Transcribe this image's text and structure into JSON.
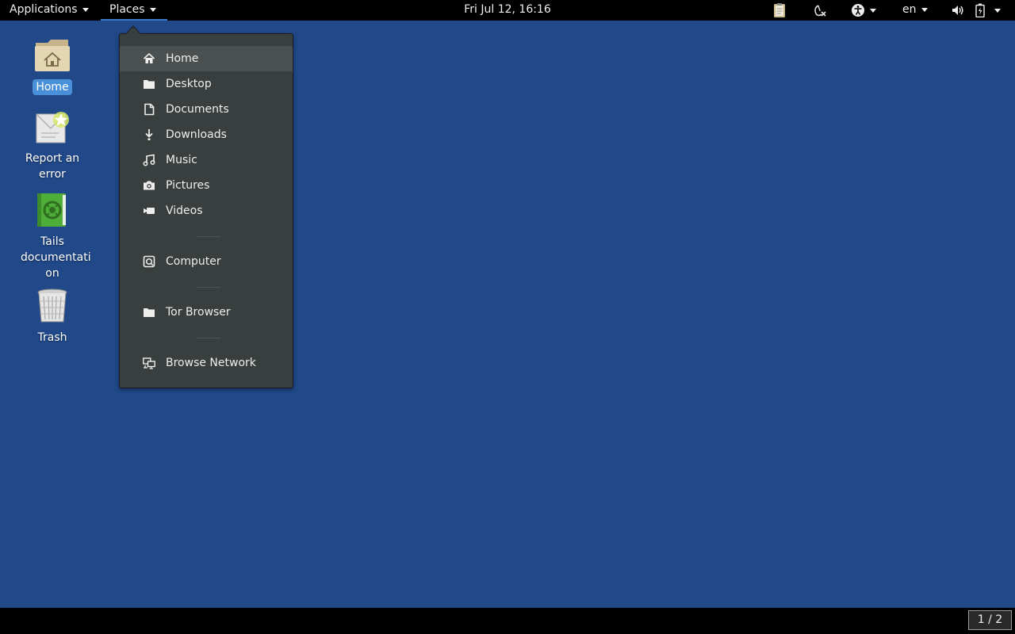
{
  "topbar": {
    "applications_label": "Applications",
    "places_label": "Places",
    "clock": "Fri Jul 12, 16:16",
    "language": "en",
    "icons": [
      "clipboard-icon",
      "tor-status-icon",
      "accessibility-icon",
      "volume-icon",
      "battery-icon"
    ]
  },
  "desktop": {
    "icons": [
      {
        "label": "Home",
        "icon": "home-folder-icon",
        "selected": true
      },
      {
        "label": "Report an error",
        "label_lines": [
          "Report an",
          "error"
        ],
        "icon": "report-error-icon"
      },
      {
        "label": "Tails documentation",
        "label_lines": [
          "Tails",
          "documentati",
          "on"
        ],
        "icon": "tails-documentation-icon"
      },
      {
        "label": "Trash",
        "icon": "trash-icon"
      }
    ]
  },
  "places_menu": {
    "items": [
      {
        "label": "Home",
        "icon": "home-icon"
      },
      {
        "label": "Desktop",
        "icon": "folder-icon"
      },
      {
        "label": "Documents",
        "icon": "document-icon"
      },
      {
        "label": "Downloads",
        "icon": "download-icon"
      },
      {
        "label": "Music",
        "icon": "music-icon"
      },
      {
        "label": "Pictures",
        "icon": "camera-icon"
      },
      {
        "label": "Videos",
        "icon": "video-icon"
      },
      {
        "label": "Computer",
        "icon": "computer-icon"
      },
      {
        "label": "Tor Browser",
        "icon": "folder-icon"
      },
      {
        "label": "Browse Network",
        "icon": "network-icon"
      }
    ],
    "hovered": "Home"
  },
  "bottombar": {
    "workspace": "1 / 2"
  },
  "colors": {
    "desktop_bg": "#21498a",
    "panel_bg": "#000000",
    "menu_bg": "#393f3f",
    "selection": "#4a90d9"
  }
}
